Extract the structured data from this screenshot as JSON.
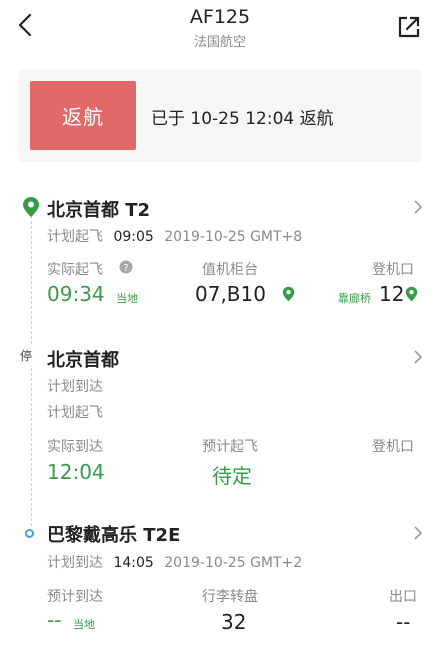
{
  "header": {
    "flight_no": "AF125",
    "airline": "法国航空"
  },
  "status": {
    "badge": "返航",
    "message": "已于 10-25 12:04 返航"
  },
  "departure": {
    "airport": "北京首都 T2",
    "plan_label": "计划起飞",
    "plan_time": "09:05",
    "plan_date": "2019-10-25 GMT+8",
    "actual_label": "实际起飞",
    "actual_time": "09:34",
    "actual_tag": "当地",
    "counter_label": "值机柜台",
    "counter_value": "07,B10",
    "gate_label": "登机口",
    "gate_tag": "靠廊桥",
    "gate_value": "12"
  },
  "stopover": {
    "badge": "停",
    "airport": "北京首都",
    "plan_arrive_label": "计划到达",
    "plan_depart_label": "计划起飞",
    "actual_arrive_label": "实际到达",
    "actual_arrive_time": "12:04",
    "est_depart_label": "预计起飞",
    "est_depart_value": "待定",
    "gate_label": "登机口"
  },
  "arrival": {
    "airport": "巴黎戴高乐 T2E",
    "plan_label": "计划到达",
    "plan_time": "14:05",
    "plan_date": "2019-10-25 GMT+2",
    "est_label": "预计到达",
    "est_time": "--",
    "est_tag": "当地",
    "baggage_label": "行李转盘",
    "baggage_value": "32",
    "exit_label": "出口",
    "exit_value": "--"
  },
  "colors": {
    "accent_green": "#3a9a4c",
    "badge_red": "#e0696a",
    "dot_blue": "#3aa3e0"
  },
  "icons": [
    "back-arrow-icon",
    "share-icon",
    "location-pin-icon",
    "help-circle-icon",
    "chevron-right-icon"
  ]
}
